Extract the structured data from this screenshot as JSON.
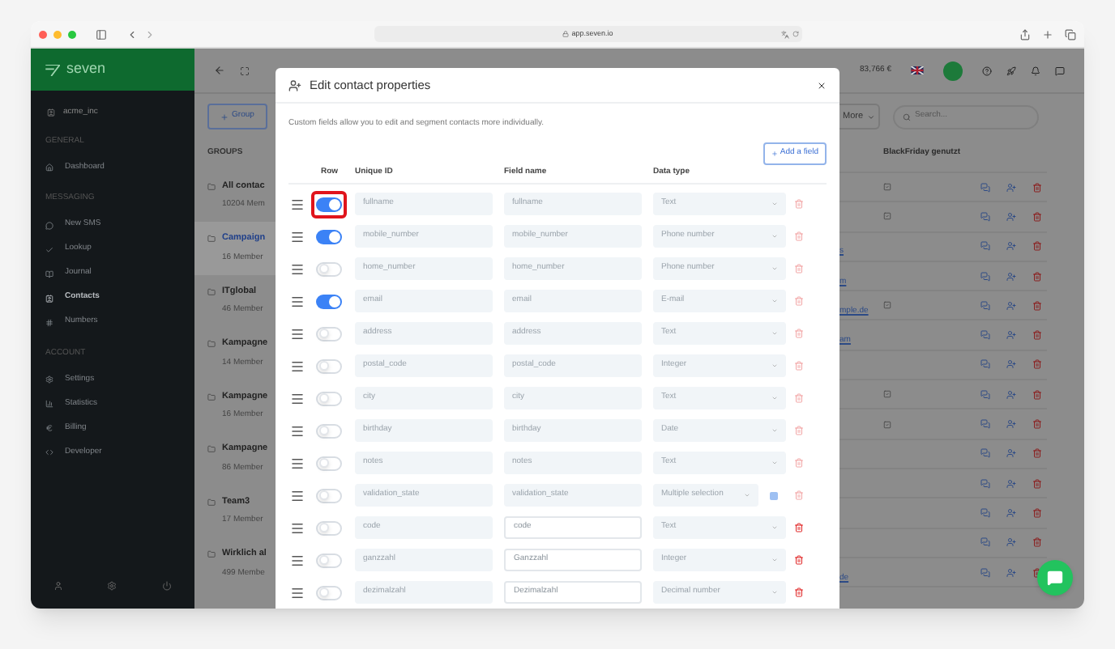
{
  "browser": {
    "url": "app.seven.io"
  },
  "sidebar": {
    "brand": "seven",
    "account": "acme_inc",
    "sections": [
      {
        "heading": "GENERAL",
        "items": [
          {
            "label": "Dashboard",
            "selected": false
          }
        ]
      },
      {
        "heading": "MESSAGING",
        "items": [
          {
            "label": "New SMS",
            "selected": false
          },
          {
            "label": "Lookup",
            "selected": false
          },
          {
            "label": "Journal",
            "selected": false
          },
          {
            "label": "Contacts",
            "selected": true
          },
          {
            "label": "Numbers",
            "selected": false
          }
        ]
      },
      {
        "heading": "ACCOUNT",
        "items": [
          {
            "label": "Settings",
            "selected": false
          },
          {
            "label": "Statistics",
            "selected": false
          },
          {
            "label": "Billing",
            "selected": false
          },
          {
            "label": "Developer",
            "selected": false
          }
        ]
      }
    ]
  },
  "topbar": {
    "balance": "83,766 €"
  },
  "groups_panel": {
    "add_button": "Group",
    "heading": "GROUPS",
    "groups": [
      {
        "name": "All contac",
        "members": "10204 Mem",
        "selected": false
      },
      {
        "name": "Campaign",
        "members": "16 Member",
        "selected": true
      },
      {
        "name": "ITglobal",
        "members": "46 Member",
        "selected": false
      },
      {
        "name": "Kampagne",
        "members": "14 Member",
        "selected": false
      },
      {
        "name": "Kampagne",
        "members": "16 Member",
        "selected": false
      },
      {
        "name": "Kampagne",
        "members": "86 Member",
        "selected": false
      },
      {
        "name": "Team3",
        "members": "17 Member",
        "selected": false
      },
      {
        "name": "Wirklich al",
        "members": "499 Membe",
        "selected": false
      }
    ]
  },
  "toolbar": {
    "more_button": "More",
    "search_placeholder": "Search..."
  },
  "contacts_table": {
    "column_header": "BlackFriday genutzt",
    "rows": [
      {
        "blackfriday": true
      },
      {
        "blackfriday": true
      },
      {
        "email": "s",
        "blackfriday": false
      },
      {
        "email": "m",
        "blackfriday": false
      },
      {
        "email": "mple.de",
        "blackfriday": true
      },
      {
        "email": "am",
        "blackfriday": false
      },
      {
        "blackfriday": false
      },
      {
        "blackfriday": true
      },
      {
        "blackfriday": true
      },
      {
        "blackfriday": false
      },
      {
        "blackfriday": false
      },
      {
        "blackfriday": false
      },
      {
        "blackfriday": false
      },
      {
        "email": "de",
        "blackfriday": false
      }
    ]
  },
  "modal": {
    "title": "Edit contact properties",
    "description": "Custom fields allow you to edit and segment contacts more individually.",
    "add_button": "Add a field",
    "columns": [
      "Row",
      "Unique ID",
      "Field name",
      "Data type"
    ],
    "fields": [
      {
        "unique_id": "fullname",
        "field_name": "fullname",
        "data_type": "Text",
        "on": true,
        "locked": true,
        "has_options": false,
        "highlighted": true
      },
      {
        "unique_id": "mobile_number",
        "field_name": "mobile_number",
        "data_type": "Phone number",
        "on": true,
        "locked": true,
        "has_options": false,
        "highlighted": false
      },
      {
        "unique_id": "home_number",
        "field_name": "home_number",
        "data_type": "Phone number",
        "on": false,
        "locked": true,
        "has_options": false,
        "highlighted": false
      },
      {
        "unique_id": "email",
        "field_name": "email",
        "data_type": "E-mail",
        "on": true,
        "locked": true,
        "has_options": false,
        "highlighted": false
      },
      {
        "unique_id": "address",
        "field_name": "address",
        "data_type": "Text",
        "on": false,
        "locked": true,
        "has_options": false,
        "highlighted": false
      },
      {
        "unique_id": "postal_code",
        "field_name": "postal_code",
        "data_type": "Integer",
        "on": false,
        "locked": true,
        "has_options": false,
        "highlighted": false
      },
      {
        "unique_id": "city",
        "field_name": "city",
        "data_type": "Text",
        "on": false,
        "locked": true,
        "has_options": false,
        "highlighted": false
      },
      {
        "unique_id": "birthday",
        "field_name": "birthday",
        "data_type": "Date",
        "on": false,
        "locked": true,
        "has_options": false,
        "highlighted": false
      },
      {
        "unique_id": "notes",
        "field_name": "notes",
        "data_type": "Text",
        "on": false,
        "locked": true,
        "has_options": false,
        "highlighted": false
      },
      {
        "unique_id": "validation_state",
        "field_name": "validation_state",
        "data_type": "Multiple selection",
        "on": false,
        "locked": true,
        "has_options": true,
        "highlighted": false
      },
      {
        "unique_id": "code",
        "field_name": "code",
        "data_type": "Text",
        "on": false,
        "locked": false,
        "has_options": false,
        "highlighted": false
      },
      {
        "unique_id": "ganzzahl",
        "field_name": "Ganzzahl",
        "data_type": "Integer",
        "on": false,
        "locked": false,
        "has_options": false,
        "highlighted": false
      },
      {
        "unique_id": "dezimalzahl",
        "field_name": "Dezimalzahl",
        "data_type": "Decimal number",
        "on": false,
        "locked": false,
        "has_options": false,
        "highlighted": false
      }
    ]
  }
}
